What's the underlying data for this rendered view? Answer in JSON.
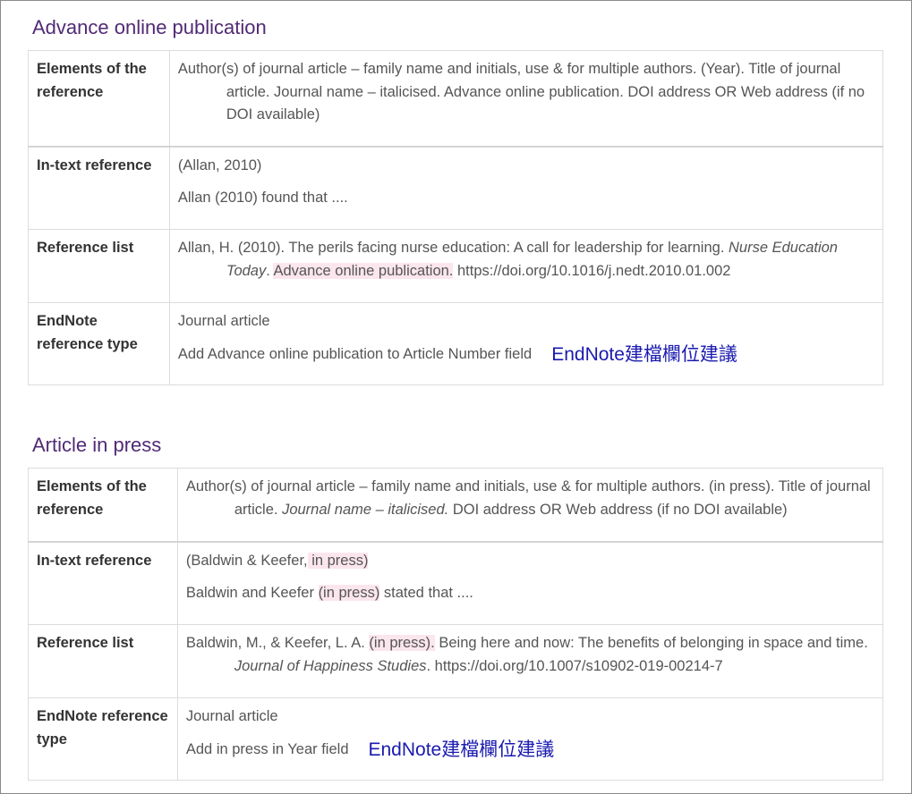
{
  "sections": [
    {
      "title": "Advance online publication",
      "rows": {
        "elements": {
          "label": "Elements of the reference",
          "text": "Author(s) of journal article – family name and initials, use & for multiple authors. (Year). Title of journal article. Journal name – italicised. Advance online publication. DOI address OR Web address (if no DOI available)"
        },
        "intext": {
          "label": "In-text reference",
          "line1": "(Allan, 2010)",
          "line2": "Allan (2010) found that ...."
        },
        "reflist": {
          "label": "Reference list",
          "part1": "Allan, H. (2010). The perils facing nurse education: A call for leadership for learning. ",
          "journal": "Nurse Education Today",
          "part2": ". ",
          "highlight": "Advance online publication.",
          "part3": " https://doi.org/10.1016/j.nedt.2010.01.002"
        },
        "endnote": {
          "label": "EndNote reference type",
          "line1": "Journal article",
          "line2": "Add Advance online publication to Article Number field",
          "note": "EndNote建檔欄位建議"
        }
      }
    },
    {
      "title": "Article in press",
      "rows": {
        "elements": {
          "label": "Elements of the reference",
          "part1": "Author(s) of journal article – family name and initials, use & for multiple authors. (in press). Title of journal article. ",
          "italic": "Journal name – italicised.",
          "part2": " DOI address OR Web address (if no DOI available)"
        },
        "intext": {
          "label": "In-text reference",
          "line1_a": "(Baldwin & Keefer,",
          "line1_hl": " in press) ",
          "line2_a": "Baldwin and Keefer ",
          "line2_hl": "(in press)",
          "line2_b": " stated that ...."
        },
        "reflist": {
          "label": "Reference list",
          "part1": "Baldwin, M., & Keefer, L. A. ",
          "highlight": "(in press).",
          "part2": " Being here and now: The benefits of belonging in space and time. ",
          "journal": "Journal of Happiness Studies",
          "part3": ". https://doi.org/10.1007/s10902-019-00214-7"
        },
        "endnote": {
          "label": "EndNote reference type",
          "line1": "Journal article",
          "line2": "Add in press in Year field",
          "note": "EndNote建檔欄位建議"
        }
      }
    }
  ]
}
